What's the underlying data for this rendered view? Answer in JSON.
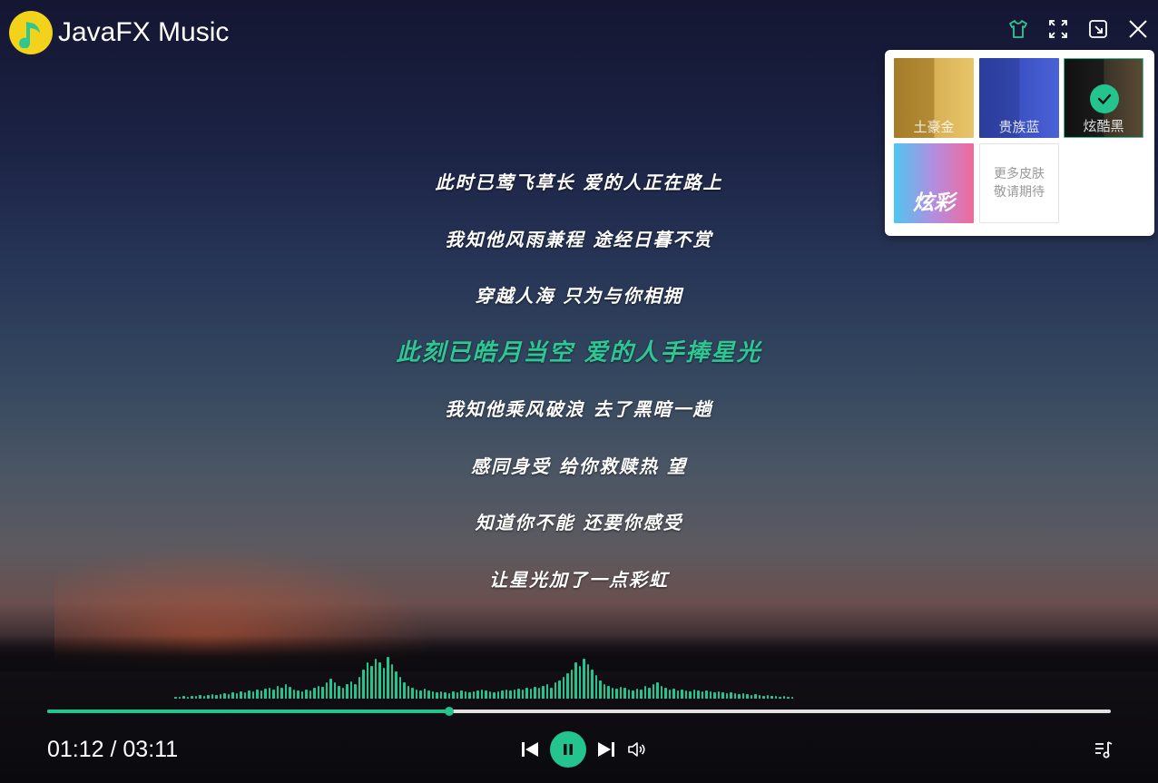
{
  "app": {
    "title": "JavaFX Music"
  },
  "skins": [
    {
      "label": "土豪金",
      "selected": false
    },
    {
      "label": "贵族蓝",
      "selected": false
    },
    {
      "label": "炫酷黑",
      "selected": true
    },
    {
      "label": "炫彩",
      "selected": false
    }
  ],
  "more_skins": {
    "line1": "更多皮肤",
    "line2": "敬请期待"
  },
  "lyrics": [
    "此时已莺飞草长 爱的人正在路上",
    "我知他风雨兼程 途经日暮不赏",
    "穿越人海 只为与你相拥",
    "此刻已皓月当空 爱的人手捧星光",
    "我知他乘风破浪 去了黑暗一趟",
    "感同身受 给你救赎热 望",
    "知道你不能 还要你感受",
    "让星光加了一点彩虹"
  ],
  "active_lyric_index": 3,
  "player": {
    "time_display": "01:12 / 03:11",
    "progress_fraction": 0.378,
    "state": "playing"
  },
  "spectrum_levels": [
    2,
    2,
    3,
    2,
    3,
    3,
    4,
    3,
    4,
    5,
    4,
    5,
    6,
    5,
    7,
    6,
    8,
    7,
    9,
    8,
    10,
    9,
    11,
    12,
    10,
    14,
    12,
    16,
    13,
    10,
    9,
    8,
    10,
    9,
    12,
    14,
    13,
    18,
    22,
    18,
    14,
    12,
    16,
    19,
    16,
    24,
    32,
    40,
    36,
    44,
    40,
    34,
    46,
    38,
    30,
    24,
    18,
    14,
    12,
    10,
    9,
    11,
    9,
    8,
    7,
    8,
    7,
    6,
    8,
    7,
    9,
    8,
    7,
    8,
    9,
    10,
    9,
    8,
    7,
    8,
    9,
    10,
    9,
    10,
    11,
    10,
    12,
    11,
    13,
    12,
    14,
    16,
    12,
    18,
    20,
    24,
    28,
    32,
    40,
    36,
    44,
    38,
    32,
    26,
    20,
    16,
    14,
    12,
    11,
    13,
    12,
    10,
    9,
    11,
    10,
    14,
    12,
    16,
    18,
    14,
    12,
    10,
    11,
    9,
    10,
    9,
    8,
    10,
    9,
    8,
    9,
    8,
    7,
    8,
    7,
    6,
    7,
    6,
    5,
    6,
    5,
    4,
    5,
    4,
    3,
    4,
    3,
    3,
    2,
    3,
    2,
    2
  ],
  "colors": {
    "accent": "#23c48e"
  }
}
